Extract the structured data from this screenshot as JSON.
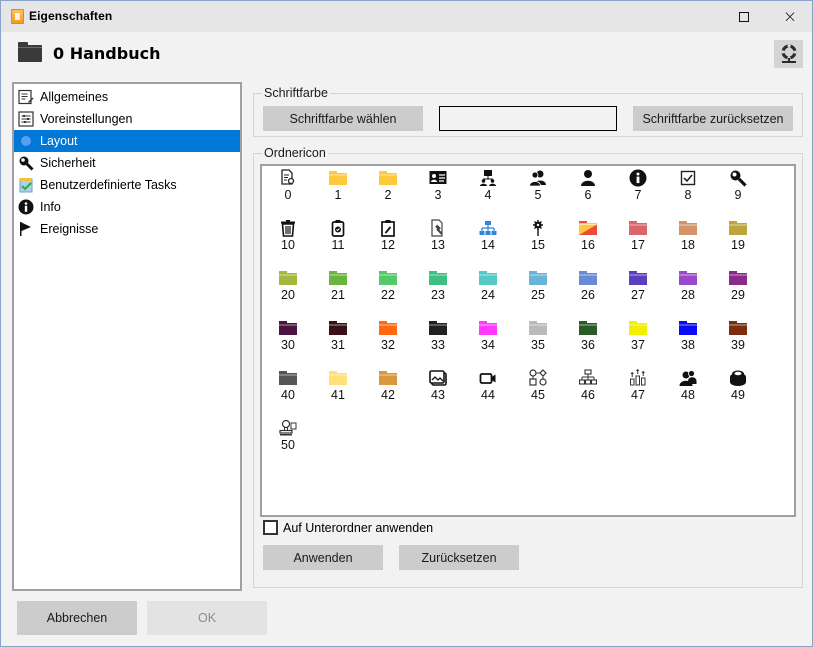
{
  "window": {
    "title": "Eigenschaften",
    "maximize_label": "maximize",
    "close_label": "×"
  },
  "header": {
    "title": "0 Handbuch",
    "help_icon": "lifebuoy-icon"
  },
  "nav": {
    "items": [
      {
        "label": "Allgemeines",
        "icon": "list-edit-icon",
        "selected": false
      },
      {
        "label": "Voreinstellungen",
        "icon": "sliders-icon",
        "selected": false
      },
      {
        "label": "Layout",
        "icon": "dot-icon",
        "selected": true
      },
      {
        "label": "Sicherheit",
        "icon": "key-icon",
        "selected": false
      },
      {
        "label": "Benutzerdefinierte Tasks",
        "icon": "task-icon",
        "selected": false
      },
      {
        "label": "Info",
        "icon": "info-icon",
        "selected": false
      },
      {
        "label": "Ereignisse",
        "icon": "flag-icon",
        "selected": false
      }
    ]
  },
  "font_color": {
    "group_label": "Schriftfarbe",
    "choose_label": "Schriftfarbe wählen",
    "reset_label": "Schriftfarbe zurücksetzen",
    "current_color": ""
  },
  "folder_icon": {
    "group_label": "Ordnericon",
    "icons": [
      {
        "n": "0",
        "type": "glyph",
        "name": "document-search-icon"
      },
      {
        "n": "1",
        "type": "folder",
        "color": "#ffc83d"
      },
      {
        "n": "2",
        "type": "folder",
        "color": "#ffc83d"
      },
      {
        "n": "3",
        "type": "glyph",
        "name": "contact-card-icon"
      },
      {
        "n": "4",
        "type": "glyph",
        "name": "org-users-icon"
      },
      {
        "n": "5",
        "type": "glyph",
        "name": "users-icon"
      },
      {
        "n": "6",
        "type": "glyph",
        "name": "user-icon"
      },
      {
        "n": "7",
        "type": "glyph",
        "name": "info-icon"
      },
      {
        "n": "8",
        "type": "glyph",
        "name": "checkbox-icon"
      },
      {
        "n": "9",
        "type": "glyph",
        "name": "key-icon"
      },
      {
        "n": "10",
        "type": "glyph",
        "name": "trash-icon"
      },
      {
        "n": "11",
        "type": "glyph",
        "name": "clipboard-check-icon"
      },
      {
        "n": "12",
        "type": "glyph",
        "name": "clipboard-edit-icon"
      },
      {
        "n": "13",
        "type": "glyph",
        "name": "document-hammer-icon"
      },
      {
        "n": "14",
        "type": "glyph",
        "name": "hierarchy-icon"
      },
      {
        "n": "15",
        "type": "glyph",
        "name": "gear-pin-icon"
      },
      {
        "n": "16",
        "type": "folder",
        "color": "#ef4b3a",
        "color2": "#ffc83d"
      },
      {
        "n": "17",
        "type": "folder",
        "color": "#d9666a"
      },
      {
        "n": "18",
        "type": "folder",
        "color": "#d4946a"
      },
      {
        "n": "19",
        "type": "folder",
        "color": "#bfa63c"
      },
      {
        "n": "20",
        "type": "folder",
        "color": "#a3b83f"
      },
      {
        "n": "21",
        "type": "folder",
        "color": "#6ab43f"
      },
      {
        "n": "22",
        "type": "folder",
        "color": "#55c86a"
      },
      {
        "n": "23",
        "type": "folder",
        "color": "#3fbf80"
      },
      {
        "n": "24",
        "type": "folder",
        "color": "#55c8c8"
      },
      {
        "n": "25",
        "type": "folder",
        "color": "#6ab4d9"
      },
      {
        "n": "26",
        "type": "folder",
        "color": "#6a8ad9"
      },
      {
        "n": "27",
        "type": "folder",
        "color": "#5a40c0"
      },
      {
        "n": "28",
        "type": "folder",
        "color": "#9a4ac8"
      },
      {
        "n": "29",
        "type": "folder",
        "color": "#8a2a8a"
      },
      {
        "n": "30",
        "type": "folder",
        "color": "#4a1540"
      },
      {
        "n": "31",
        "type": "folder",
        "color": "#3a1018"
      },
      {
        "n": "32",
        "type": "folder",
        "color": "#ff6a10"
      },
      {
        "n": "33",
        "type": "folder",
        "color": "#1f2221"
      },
      {
        "n": "34",
        "type": "folder",
        "color": "#ff3aff"
      },
      {
        "n": "35",
        "type": "folder",
        "color": "#bababa"
      },
      {
        "n": "36",
        "type": "folder",
        "color": "#2a5a2a"
      },
      {
        "n": "37",
        "type": "folder",
        "color": "#f0f000"
      },
      {
        "n": "38",
        "type": "folder",
        "color": "#0a0af5"
      },
      {
        "n": "39",
        "type": "folder",
        "color": "#7a3010"
      },
      {
        "n": "40",
        "type": "folder",
        "color": "#555555"
      },
      {
        "n": "41",
        "type": "folder",
        "color": "#ffe07a"
      },
      {
        "n": "42",
        "type": "folder",
        "color": "#d9963c"
      },
      {
        "n": "43",
        "type": "glyph",
        "name": "image-gallery-icon"
      },
      {
        "n": "44",
        "type": "glyph",
        "name": "video-camera-icon"
      },
      {
        "n": "45",
        "type": "glyph",
        "name": "workflow-shapes-icon"
      },
      {
        "n": "46",
        "type": "glyph",
        "name": "org-chart-icon"
      },
      {
        "n": "47",
        "type": "glyph",
        "name": "bar-chart-arrows-icon"
      },
      {
        "n": "48",
        "type": "glyph",
        "name": "user-group-icon"
      },
      {
        "n": "49",
        "type": "glyph",
        "name": "coin-stack-icon"
      },
      {
        "n": "50",
        "type": "glyph",
        "name": "stamp-icon"
      }
    ],
    "apply_subfolders_label": "Auf Unterordner anwenden",
    "apply_subfolders_checked": false,
    "apply_label": "Anwenden",
    "reset_label": "Zurücksetzen"
  },
  "footer": {
    "cancel_label": "Abbrechen",
    "ok_label": "OK"
  },
  "colors": {
    "selection": "#0078d7",
    "button": "#cccccc",
    "button_disabled": "#e3e3e3"
  }
}
